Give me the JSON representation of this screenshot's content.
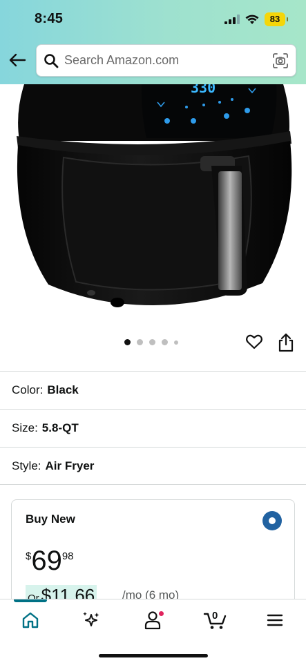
{
  "status_bar": {
    "time": "8:45",
    "battery": "83",
    "battery_color": "#f5d60a"
  },
  "search": {
    "placeholder": "Search Amazon.com"
  },
  "product_image": {
    "display_text": "330"
  },
  "carousel": {
    "count": 5,
    "active_index": 0
  },
  "variations": [
    {
      "label": "Color:",
      "value": "Black"
    },
    {
      "label": "Size:",
      "value": "5.8-QT"
    },
    {
      "label": "Style:",
      "value": "Air Fryer"
    }
  ],
  "buy_box": {
    "title": "Buy New",
    "price_symbol": "$",
    "price_whole": "69",
    "price_fraction": "98",
    "monthly_prefix": "Or",
    "monthly_amount": "$11.66",
    "monthly_note": "/mo (6 mo)"
  },
  "bottom_nav": {
    "items": [
      "home-icon",
      "rufus-sparkle-icon",
      "account-icon",
      "cart-icon",
      "menu-icon"
    ],
    "active": "home-icon",
    "cart_count": "0",
    "accent_color": "#007185"
  }
}
